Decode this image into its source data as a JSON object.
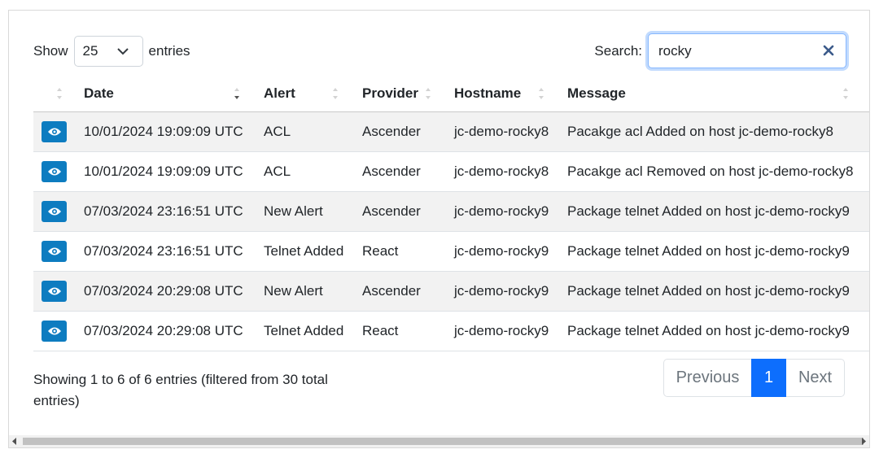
{
  "length": {
    "show_label": "Show",
    "selected": "25",
    "entries_label": "entries"
  },
  "search": {
    "label": "Search:",
    "value": "rocky"
  },
  "columns": [
    "",
    "Date",
    "Alert",
    "Provider",
    "Hostname",
    "Message"
  ],
  "rows": [
    {
      "date": "10/01/2024 19:09:09 UTC",
      "alert": "ACL",
      "provider": "Ascender",
      "hostname": "jc-demo-rocky8",
      "message": "Pacakge acl Added on host jc-demo-rocky8"
    },
    {
      "date": "10/01/2024 19:09:09 UTC",
      "alert": "ACL",
      "provider": "Ascender",
      "hostname": "jc-demo-rocky8",
      "message": "Pacakge acl Removed on host jc-demo-rocky8"
    },
    {
      "date": "07/03/2024 23:16:51 UTC",
      "alert": "New Alert",
      "provider": "Ascender",
      "hostname": "jc-demo-rocky9",
      "message": "Package telnet Added on host jc-demo-rocky9"
    },
    {
      "date": "07/03/2024 23:16:51 UTC",
      "alert": "Telnet Added",
      "provider": "React",
      "hostname": "jc-demo-rocky9",
      "message": "Package telnet Added on host jc-demo-rocky9"
    },
    {
      "date": "07/03/2024 20:29:08 UTC",
      "alert": "New Alert",
      "provider": "Ascender",
      "hostname": "jc-demo-rocky9",
      "message": "Package telnet Added on host jc-demo-rocky9"
    },
    {
      "date": "07/03/2024 20:29:08 UTC",
      "alert": "Telnet Added",
      "provider": "React",
      "hostname": "jc-demo-rocky9",
      "message": "Package telnet Added on host jc-demo-rocky9"
    }
  ],
  "info": "Showing 1 to 6 of 6 entries (filtered from 30 total entries)",
  "pagination": {
    "previous": "Previous",
    "current": "1",
    "next": "Next"
  },
  "icons": {
    "view": "eye-icon",
    "clear": "close-icon",
    "dropdown": "chevron-down-icon",
    "sort": "sort-icon"
  },
  "colors": {
    "view_button": "#0d7cc0",
    "page_active": "#0d6efd",
    "row_stripe": "#f2f2f2",
    "focus_border": "#86b7fe"
  }
}
